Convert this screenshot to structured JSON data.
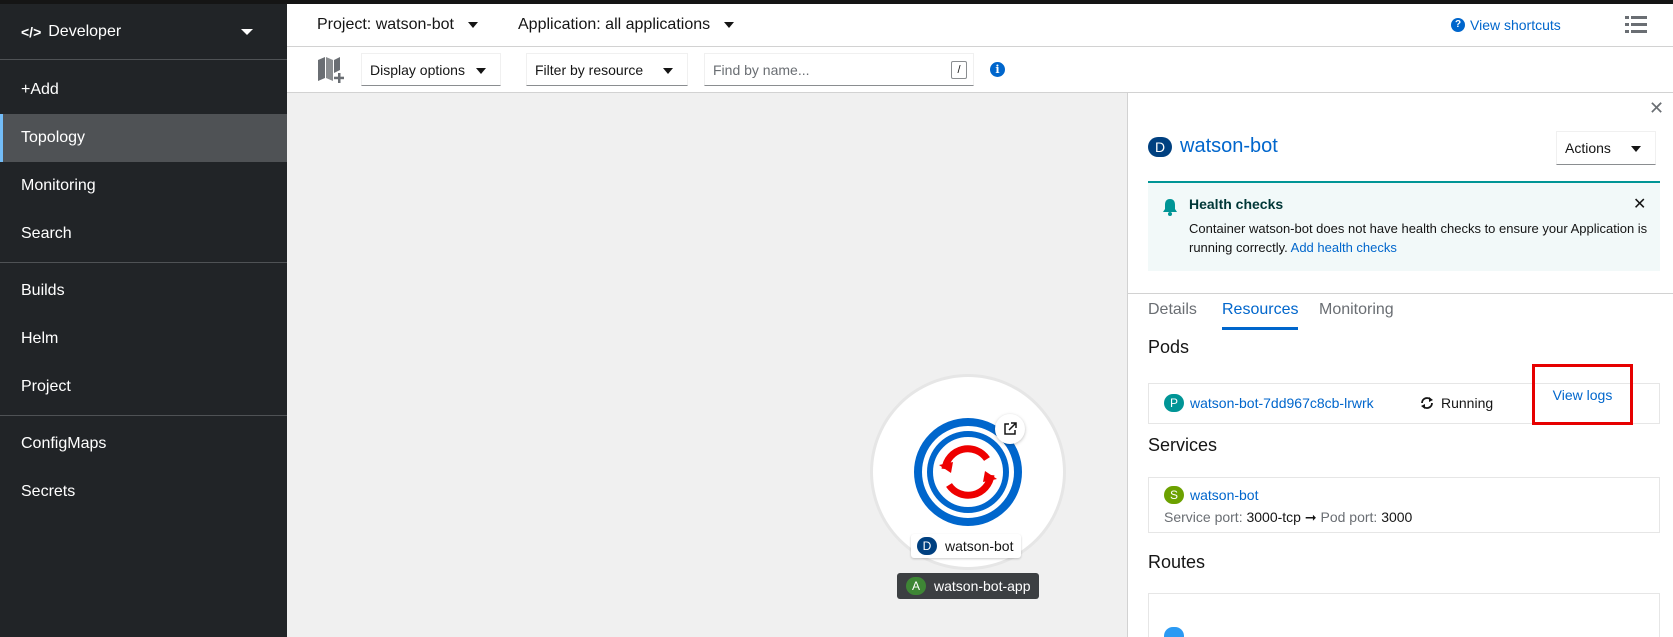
{
  "sidebar": {
    "perspective": {
      "icon": "code-icon",
      "label": "Developer"
    },
    "items": [
      {
        "label": "+Add"
      },
      {
        "label": "Topology",
        "active": true
      },
      {
        "label": "Monitoring"
      },
      {
        "label": "Search"
      },
      {
        "label": "Builds"
      },
      {
        "label": "Helm"
      },
      {
        "label": "Project"
      },
      {
        "label": "ConfigMaps"
      },
      {
        "label": "Secrets"
      }
    ]
  },
  "masthead": {
    "project": "Project: watson-bot",
    "application": "Application: all applications",
    "shortcuts": "View shortcuts"
  },
  "toolbar": {
    "display_options": "Display options",
    "filter": "Filter by resource",
    "search_placeholder": "Find by name...",
    "search_shortcut": "/"
  },
  "topology": {
    "node": {
      "badge": "D",
      "name": "watson-bot"
    },
    "app": {
      "badge": "A",
      "name": "watson-bot-app"
    }
  },
  "panel": {
    "badge": "D",
    "title": "watson-bot",
    "actions": "Actions",
    "alert": {
      "title": "Health checks",
      "body": "Container watson-bot does not have health checks to ensure your Application is running correctly.",
      "link": "Add health checks"
    },
    "tabs": [
      "Details",
      "Resources",
      "Monitoring"
    ],
    "active_tab": "Resources",
    "pods": {
      "heading": "Pods",
      "badge": "P",
      "name": "watson-bot-7dd967c8cb-lrwrk",
      "status": "Running",
      "view_logs": "View logs"
    },
    "services": {
      "heading": "Services",
      "badge": "S",
      "name": "watson-bot",
      "service_port_label": "Service port:",
      "service_port": "3000-tcp",
      "arrow": "➞",
      "pod_port_label": "Pod port:",
      "pod_port": "3000"
    },
    "routes": {
      "heading": "Routes"
    }
  },
  "colors": {
    "sidebar_bg": "#212427",
    "link": "#0066cc",
    "highlight_box": "#e60000",
    "alert_accent": "#009596"
  }
}
